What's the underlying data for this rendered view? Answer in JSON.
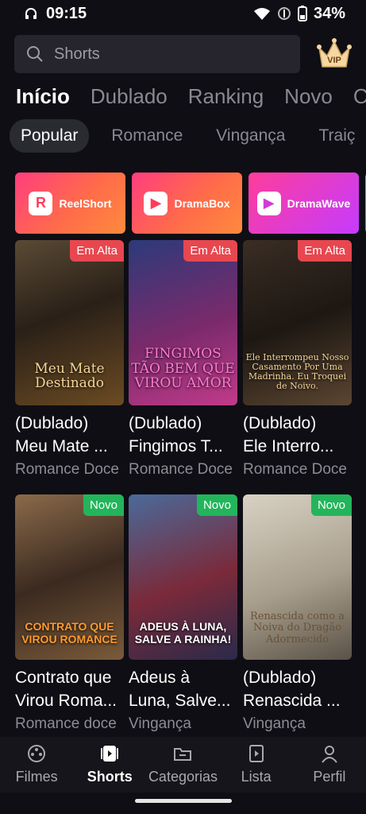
{
  "status": {
    "time": "09:15",
    "battery": "34%"
  },
  "search": {
    "placeholder": "Shorts"
  },
  "vip": {
    "label": "VIP"
  },
  "tabs": [
    {
      "label": "Início",
      "active": true
    },
    {
      "label": "Dublado"
    },
    {
      "label": "Ranking"
    },
    {
      "label": "Novo"
    },
    {
      "label": "Cat"
    }
  ],
  "chips": [
    {
      "label": "Popular",
      "active": true
    },
    {
      "label": "Romance"
    },
    {
      "label": "Vingança"
    },
    {
      "label": "Traiç"
    }
  ],
  "brands": [
    {
      "name": "ReelShort",
      "logo": "R"
    },
    {
      "name": "DramaBox",
      "logo": "▶"
    },
    {
      "name": "DramaWave",
      "logo": "▶"
    }
  ],
  "cards": [
    {
      "badge": "Em Alta",
      "art": "Meu Mate Destinado",
      "title": "(Dublado)",
      "title2": "Meu Mate ...",
      "genre": "Romance Doce"
    },
    {
      "badge": "Em Alta",
      "art": "FINGIMOS TÃO BEM QUE VIROU AMOR",
      "title": "(Dublado)",
      "title2": "Fingimos T...",
      "genre": "Romance Doce"
    },
    {
      "badge": "Em Alta",
      "art": "Ele Interrompeu Nosso Casamento Por Uma Madrinha. Eu Troquei de Noivo.",
      "title": "(Dublado)",
      "title2": "Ele Interro...",
      "genre": "Romance Doce"
    },
    {
      "badge": "Novo",
      "art": "CONTRATO QUE VIROU ROMANCE",
      "title": "Contrato que",
      "title2": "Virou Roma...",
      "genre": "Romance doce"
    },
    {
      "badge": "Novo",
      "art": "ADEUS À LUNA, SALVE A RAINHA!",
      "title": "Adeus à",
      "title2": "Luna, Salve...",
      "genre": "Vingança"
    },
    {
      "badge": "Novo",
      "art": "Renascida como a Noiva do Dragão Adormecido",
      "title": "(Dublado)",
      "title2": "Renascida ...",
      "genre": "Vingança"
    }
  ],
  "nav": [
    {
      "label": "Filmes",
      "icon": "film-reel-icon"
    },
    {
      "label": "Shorts",
      "icon": "shorts-play-icon",
      "active": true
    },
    {
      "label": "Categorias",
      "icon": "folder-icon"
    },
    {
      "label": "Lista",
      "icon": "bookmark-play-icon"
    },
    {
      "label": "Perfil",
      "icon": "person-icon"
    }
  ]
}
